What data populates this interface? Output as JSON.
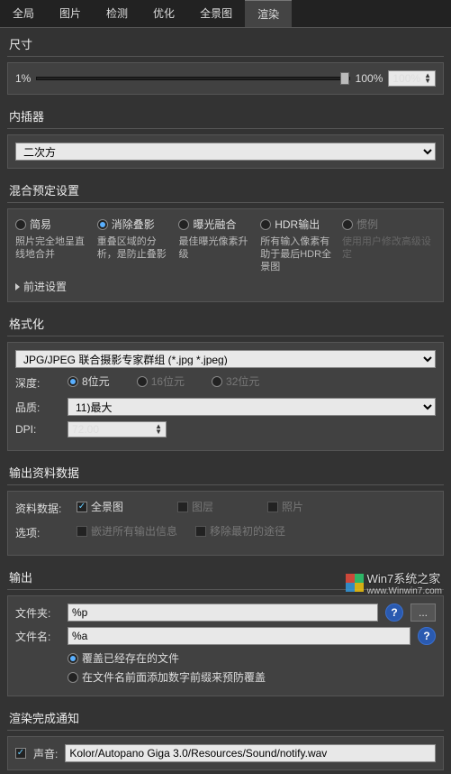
{
  "tabs": [
    "全局",
    "图片",
    "检测",
    "优化",
    "全景图",
    "渲染"
  ],
  "activeTab": 5,
  "size": {
    "header": "尺寸",
    "min": "1%",
    "max": "100%",
    "value": "100%"
  },
  "interp": {
    "header": "内插器",
    "value": "二次方"
  },
  "blend": {
    "header": "混合预定设置",
    "opts": [
      {
        "label": "简易",
        "desc": "照片完全地呈直线地合并"
      },
      {
        "label": "消除叠影",
        "desc": "重叠区域的分析，是防止叠影"
      },
      {
        "label": "曝光融合",
        "desc": "最佳曝光像素升级"
      },
      {
        "label": "HDR输出",
        "desc": "所有输入像素有助于最后HDR全景图"
      },
      {
        "label": "惯例",
        "desc": "使用用户修改高级设定"
      }
    ],
    "selected": 1,
    "advance": "前进设置"
  },
  "format": {
    "header": "格式化",
    "file": "JPG/JPEG 联合摄影专家群组 (*.jpg *.jpeg)",
    "depthLabel": "深度:",
    "depths": [
      "8位元",
      "16位元",
      "32位元"
    ],
    "depthSel": 0,
    "qualityLabel": "品质:",
    "quality": "11)最大",
    "dpiLabel": "DPI:",
    "dpi": "72.00"
  },
  "outdata": {
    "header": "输出资料数据",
    "rowLabel": "资料数据:",
    "items": [
      "全景图",
      "图层",
      "照片"
    ],
    "checked": [
      true,
      false,
      false
    ],
    "optLabel": "选项:",
    "opts": [
      "嵌进所有输出信息",
      "移除最初的途径"
    ]
  },
  "output": {
    "header": "输出",
    "folderLabel": "文件夹:",
    "folder": "%p",
    "nameLabel": "文件名:",
    "name": "%a",
    "r1": "覆盖已经存在的文件",
    "r2": "在文件名前面添加数字前缀来预防覆盖"
  },
  "notify": {
    "header": "渲染完成通知",
    "soundLabel": "声音:",
    "sound": "Kolor/Autopano Giga 3.0/Resources/Sound/notify.wav"
  },
  "wm": {
    "title": "Win7系统之家",
    "sub": "www.Winwin7.com"
  }
}
